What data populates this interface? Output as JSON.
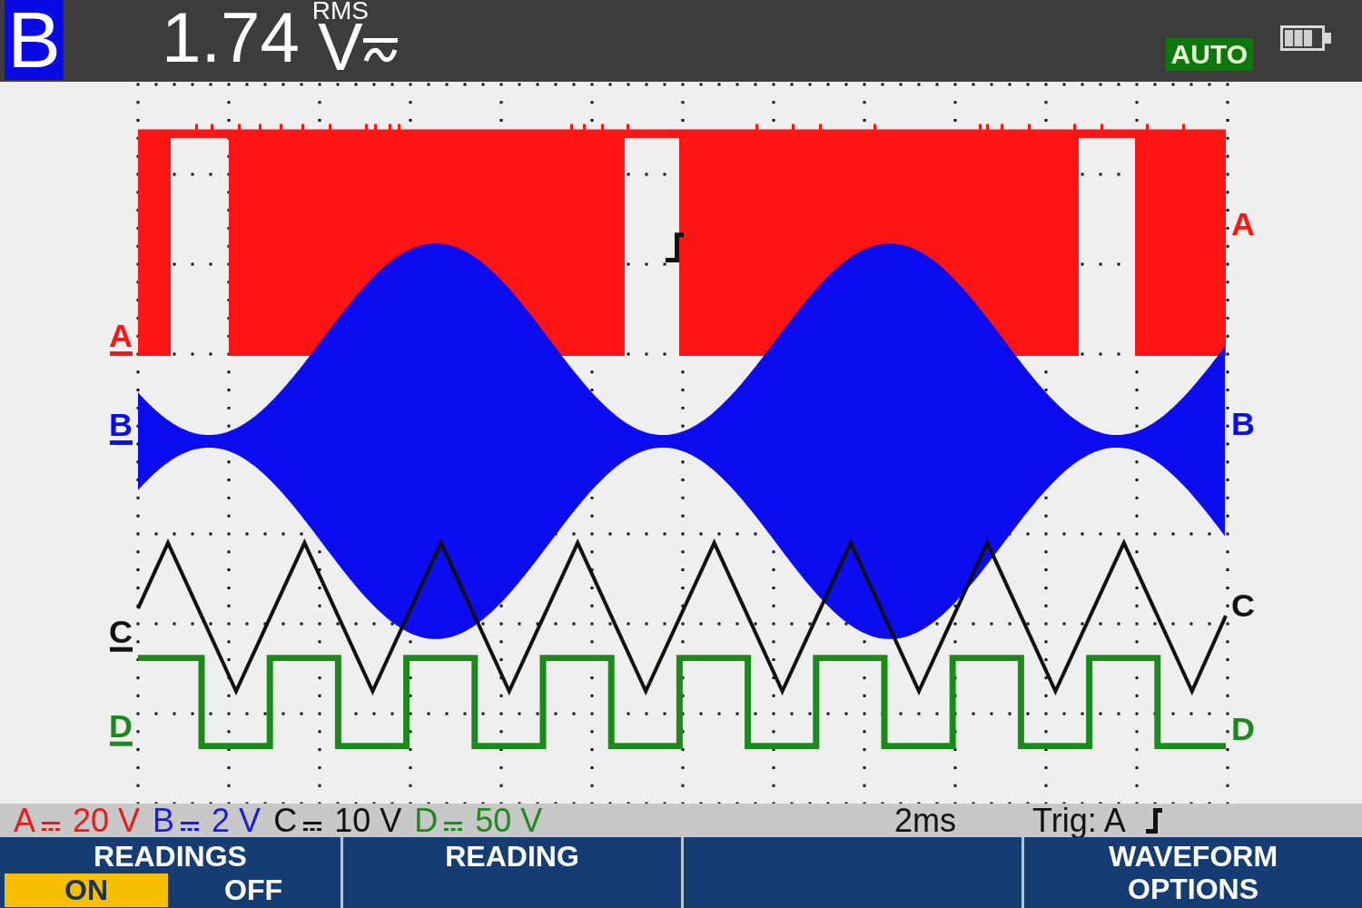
{
  "header": {
    "channel": "B",
    "reading": "1.74",
    "qualifier": "RMS",
    "unit": "V",
    "mode_badge": "AUTO"
  },
  "plot": {
    "traces": [
      {
        "kind": "pulse",
        "color": "#ff1414",
        "left_marker": "A",
        "right_label": "A"
      },
      {
        "kind": "modulated",
        "color": "#0c0cf0",
        "left_marker": "B",
        "right_label": "B"
      },
      {
        "kind": "triangle",
        "color": "#111111",
        "left_marker": "C",
        "right_label": "C"
      },
      {
        "kind": "square",
        "color": "#1b8a1b",
        "left_marker": "D",
        "right_label": "D"
      }
    ]
  },
  "status_bar": {
    "scales": [
      {
        "channel": "A",
        "value": "20 V",
        "color": "#e41c1c"
      },
      {
        "channel": "B",
        "value": "2 V",
        "color": "#1a1ae0"
      },
      {
        "channel": "C",
        "value": "10 V",
        "color": "#111111"
      },
      {
        "channel": "D",
        "value": "50 V",
        "color": "#1f8a1f"
      }
    ],
    "timebase": "2ms",
    "trigger_source": "Trig: A"
  },
  "softkeys": [
    {
      "kind": "toggle",
      "title": "READINGS",
      "options": [
        {
          "label": "ON",
          "selected": true
        },
        {
          "label": "OFF",
          "selected": false
        }
      ]
    },
    {
      "kind": "label",
      "title": "READING"
    },
    {
      "kind": "blank"
    },
    {
      "kind": "label",
      "title": "WAVEFORM OPTIONS"
    }
  ]
}
